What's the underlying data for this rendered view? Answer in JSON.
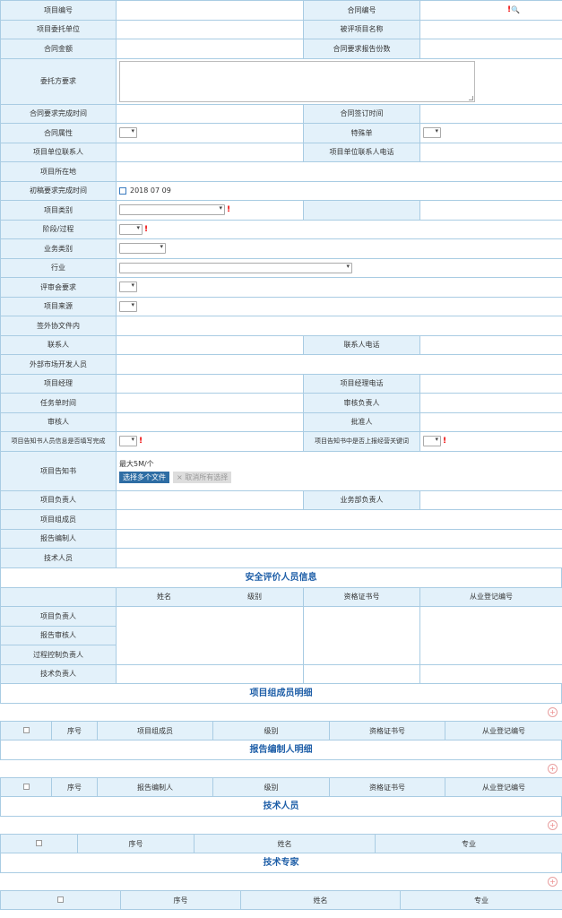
{
  "form": {
    "project_no": "项目编号",
    "contract_no": "合同编号",
    "search_icon_text": "",
    "req_mark": "!",
    "client_unit": "项目委托单位",
    "eval_project_name": "被评项目名称",
    "contract_amount": "合同金额",
    "report_fee": "合同要求报告份数",
    "scope": "委托方要求",
    "req_finish_time": "合同要求完成时间",
    "sign_time": "合同签订时间",
    "contract_attr": "合同属性",
    "special": "特殊单",
    "client_contact": "项目单位联系人",
    "client_phone": "项目单位联系人电话",
    "location": "项目所在地",
    "first_req_time": "初稿要求完成时间",
    "first_req_value": "2018 07 09",
    "project_type": "项目类别",
    "stage": "阶段/过程",
    "business_cat": "业务类别",
    "industry": "行业",
    "eval_req": "评审会要求",
    "source": "项目来源",
    "external_org": "签外协文件内",
    "contact": "联系人",
    "contact_phone": "联系人电话",
    "market_person": "外部市场开发人员",
    "manager": "项目经理",
    "manager_phone": "项目经理电话",
    "task_time": "任务单时间",
    "review_owner": "审核负责人",
    "reviewer": "审核人",
    "approver": "批准人",
    "resp_filled": "项目告知书人员信息是否填写完成",
    "resp_confirmed": "项目告知书中是否上报经营关键词",
    "notice": "项目告知书",
    "file_limit": "最大5M/个",
    "upload_btn": "选择多个文件",
    "cancel_upload": "× 取消所有选择",
    "project_lead": "项目负责人",
    "biz_lead": "业务部负责人",
    "team_members": "项目组成员",
    "report_writers": "报告编制人",
    "tech_staff": "技术人员"
  },
  "safety": {
    "title": "安全评价人员信息",
    "headers": [
      "",
      "姓名",
      "级别",
      "资格证书号",
      "从业登记编号"
    ],
    "rows": [
      "项目负责人",
      "报告审核人",
      "过程控制负责人",
      "技术负责人"
    ]
  },
  "team": {
    "title": "项目组成员明细",
    "headers": [
      "",
      "序号",
      "项目组成员",
      "级别",
      "资格证书号",
      "从业登记编号"
    ]
  },
  "report": {
    "title": "报告编制人明细",
    "headers": [
      "",
      "序号",
      "报告编制人",
      "级别",
      "资格证书号",
      "从业登记编号"
    ]
  },
  "tech": {
    "title": "技术人员",
    "headers": [
      "",
      "序号",
      "姓名",
      "专业"
    ]
  },
  "experts": {
    "title": "技术专家",
    "headers": [
      "",
      "序号",
      "姓名",
      "专业"
    ]
  },
  "add_icon": "+"
}
